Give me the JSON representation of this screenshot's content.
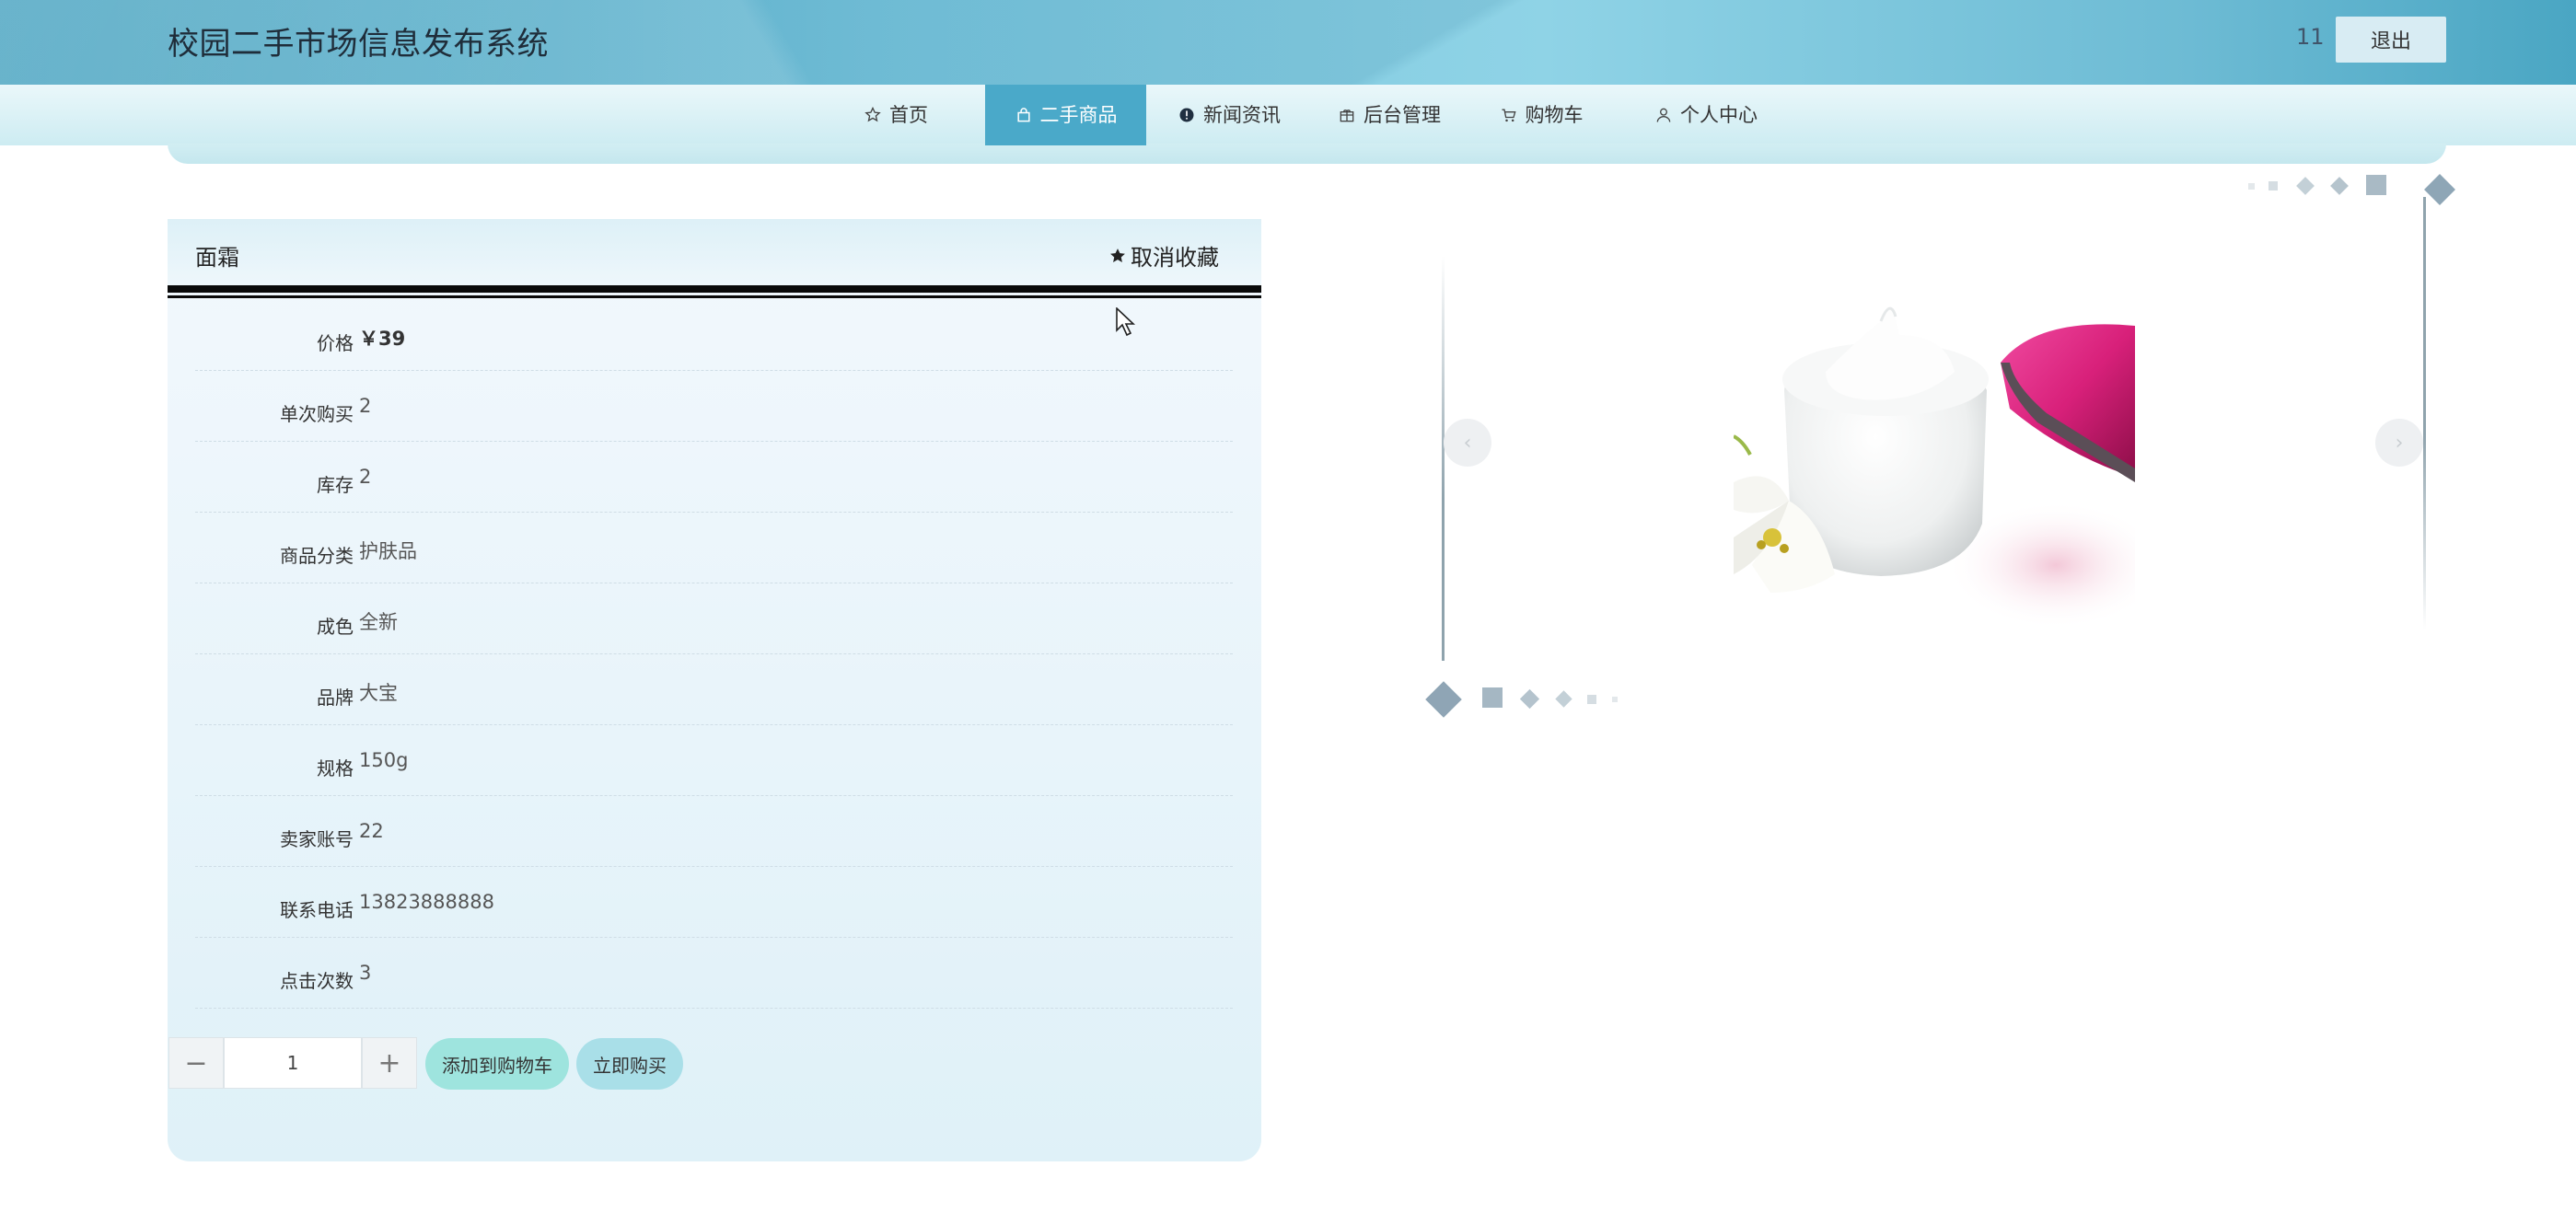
{
  "header": {
    "site_title": "校园二手市场信息发布系统",
    "user_name": "11",
    "logout_label": "退出"
  },
  "nav": {
    "items": [
      {
        "label": "首页",
        "icon": "star-outline-icon"
      },
      {
        "label": "二手商品",
        "icon": "bag-icon",
        "active": true
      },
      {
        "label": "新闻资讯",
        "icon": "info-circle-icon"
      },
      {
        "label": "后台管理",
        "icon": "gift-box-icon"
      },
      {
        "label": "购物车",
        "icon": "cart-icon"
      },
      {
        "label": "个人中心",
        "icon": "user-icon"
      }
    ]
  },
  "product": {
    "title": "面霜",
    "favorite_label": "取消收藏",
    "fields": [
      {
        "label": "价格",
        "value": "￥39"
      },
      {
        "label": "单次购买",
        "value": "2"
      },
      {
        "label": "库存",
        "value": "2"
      },
      {
        "label": "商品分类",
        "value": "护肤品"
      },
      {
        "label": "成色",
        "value": "全新"
      },
      {
        "label": "品牌",
        "value": "大宝"
      },
      {
        "label": "规格",
        "value": "150g"
      },
      {
        "label": "卖家账号",
        "value": "22"
      },
      {
        "label": "联系电话",
        "value": "13823888888"
      },
      {
        "label": "点击次数",
        "value": "3"
      }
    ]
  },
  "purchase": {
    "quantity": "1",
    "minus_label": "−",
    "plus_label": "+",
    "add_to_cart_label": "添加到购物车",
    "buy_now_label": "立即购买"
  },
  "carousel": {
    "prev_label": "‹",
    "next_label": "›"
  },
  "colors": {
    "accent": "#4aa9c9",
    "cart_button": "#9ee4de",
    "buy_button": "#a9dfe8"
  }
}
